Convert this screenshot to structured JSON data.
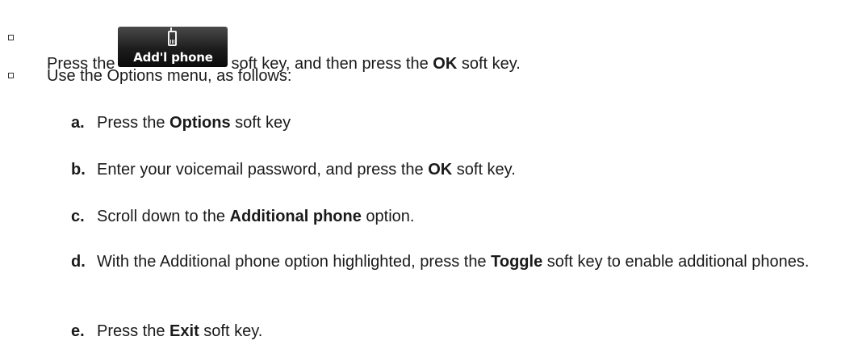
{
  "bullet1": {
    "before": "Press the",
    "softkey_label": "Add'l phone",
    "after_a": "soft key, and then press the",
    "ok": "OK",
    "after_b": "soft key."
  },
  "bullet2": {
    "text": "Use the Options menu, as follows:"
  },
  "steps": [
    {
      "letter": "a.",
      "before": "Press the",
      "bold": "Options",
      "after": "soft key"
    },
    {
      "letter": "b.",
      "before": "Enter your voicemail password, and press the",
      "bold": "OK",
      "after": "soft key."
    },
    {
      "letter": "c.",
      "before": "Scroll down to the",
      "bold": "Additional phone",
      "after": "option."
    },
    {
      "letter": "d.",
      "before": "With the Additional phone option highlighted, press the",
      "bold": "Toggle",
      "after": "soft key to enable additional phones."
    },
    {
      "letter": "e.",
      "before": "Press the",
      "bold": "Exit",
      "after": "soft key."
    }
  ]
}
